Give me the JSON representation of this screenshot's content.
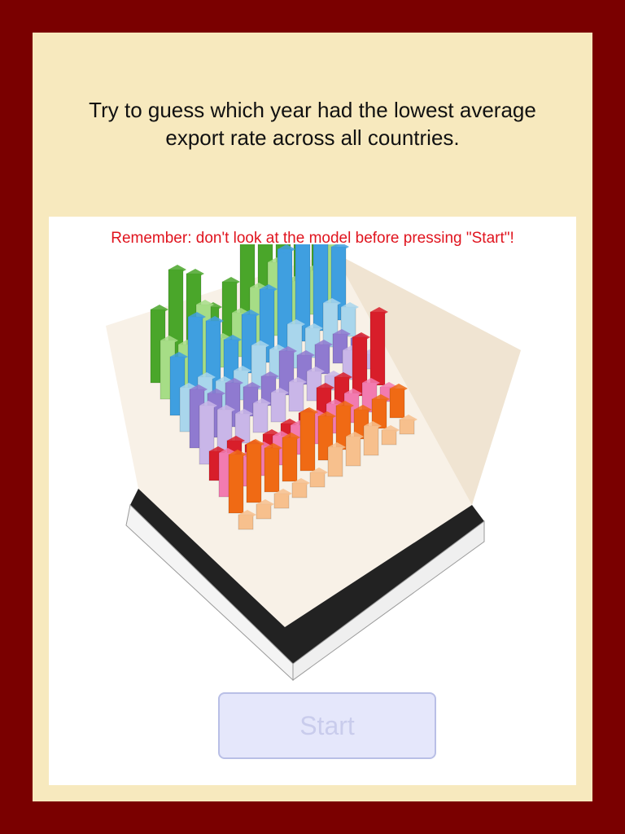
{
  "question": {
    "line1": "Try to guess which year had the lowest average",
    "line2": "export rate across all countries."
  },
  "reminder": "Remember: don't look at the model before pressing \"Start\"!",
  "start_button": {
    "label": "Start",
    "enabled": false
  },
  "model": {
    "description_icon": "3d-physical-bar-chart-model",
    "row_colors": [
      "#4aa62a",
      "#a6dd86",
      "#3f9fe0",
      "#a9d6ec",
      "#8f7ad0",
      "#c9b6e8",
      "#d81e2a",
      "#f27bb0",
      "#f06a14",
      "#f7c08d"
    ]
  },
  "colors": {
    "outer_border": "#7a0000",
    "frame_background": "#f7e9be",
    "reminder_text": "#e0141e"
  }
}
